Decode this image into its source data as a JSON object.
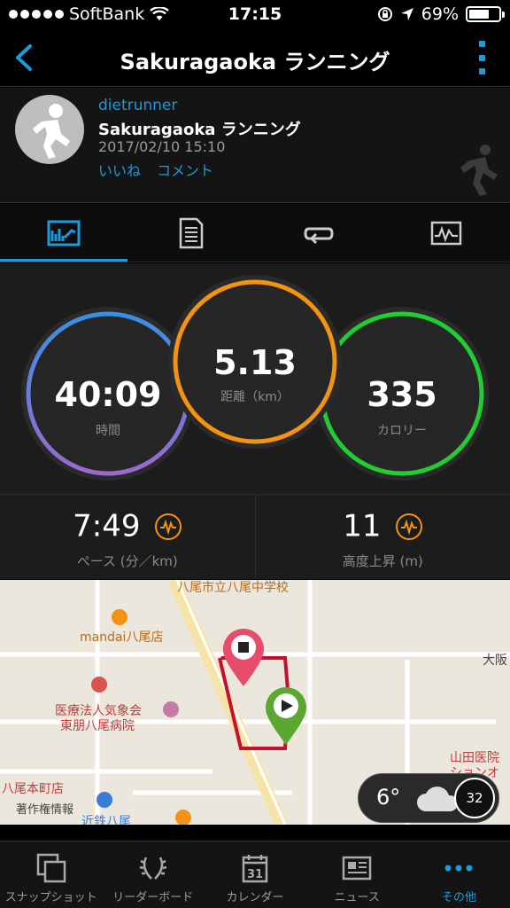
{
  "status_bar": {
    "carrier": "SoftBank",
    "time": "17:15",
    "battery": "69%",
    "battery_level": 0.69
  },
  "nav": {
    "title": "Sakuragaoka ランニング"
  },
  "activity": {
    "user": "dietrunner",
    "title": "Sakuragaoka ランニング",
    "date": "2017/02/10 15:10",
    "like": "いいね",
    "comment": "コメント"
  },
  "tabs": [
    {
      "name": "tab-summary",
      "icon": "chart-icon"
    },
    {
      "name": "tab-details",
      "icon": "document-icon"
    },
    {
      "name": "tab-laps",
      "icon": "loop-icon"
    },
    {
      "name": "tab-graphs",
      "icon": "graph-icon"
    }
  ],
  "stats": {
    "time": {
      "value": "40:09",
      "label": "時間",
      "color": "#7f6ad0"
    },
    "distance": {
      "value": "5.13",
      "label": "距離（km）",
      "color": "#f29312"
    },
    "calories": {
      "value": "335",
      "label": "カロリー",
      "color": "#22cc33"
    },
    "pace": {
      "value": "7:49",
      "label": "ペース (分／km)"
    },
    "elevation": {
      "value": "11",
      "label": "高度上昇 (m)"
    }
  },
  "map": {
    "labels": {
      "school": "八尾市立八尾中学校",
      "mandai": "mandai八尾店",
      "osaka": "大阪",
      "hospital1": "医療法人気象会",
      "hospital2": "東朋八尾病院",
      "yamada1": "山田医院",
      "yamada2": "ションオ",
      "yaohonmachi": "八尾本町店",
      "copyright": "著作権情報",
      "kintetsu": "近鉄八尾"
    },
    "route_color": "#c8102e",
    "weather": {
      "temp": "6°",
      "wind": "32"
    }
  },
  "bottom_tabs": [
    {
      "label": "スナップショット",
      "icon": "snapshot-icon"
    },
    {
      "label": "リーダーボード",
      "icon": "laurel-icon"
    },
    {
      "label": "カレンダー",
      "icon": "calendar-icon",
      "day": "31"
    },
    {
      "label": "ニュース",
      "icon": "news-icon"
    },
    {
      "label": "その他",
      "icon": "more-dots-icon"
    }
  ],
  "accent": "#1a9bdb"
}
